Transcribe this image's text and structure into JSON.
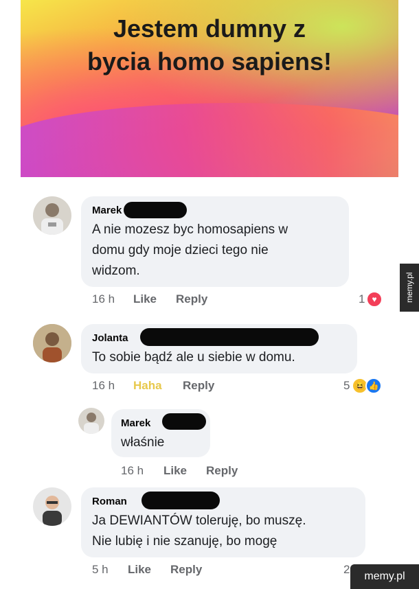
{
  "post": {
    "title_line1": "Jestem dumny z",
    "title_line2": "bycia homo sapiens!"
  },
  "comments": [
    {
      "name": "Marek",
      "lines": [
        "A nie mozesz byc homosapiens w",
        "domu gdy moje dzieci tego nie",
        "widzom."
      ],
      "time": "16 h",
      "like": "Like",
      "reply": "Reply",
      "reaction_count": "1",
      "reaction": "love"
    },
    {
      "name": "Jolanta",
      "lines": [
        "To sobie bądź ale u siebie w domu."
      ],
      "time": "16 h",
      "like": "Haha",
      "reply": "Reply",
      "reaction_count": "5",
      "reaction": "haha+like"
    },
    {
      "name": "Marek",
      "lines": [
        "właśnie"
      ],
      "time": "16 h",
      "like": "Like",
      "reply": "Reply"
    },
    {
      "name": "Roman",
      "lines": [
        "Ja DEWIANTÓW toleruję, bo muszę.",
        "Nie lubię i nie szanuję, bo mogę"
      ],
      "time": "5 h",
      "like": "Like",
      "reply": "Reply",
      "reaction_count": "2"
    }
  ],
  "watermark": {
    "side": "memy.pl",
    "bottom": "memy.pl"
  },
  "colors": {
    "bubble": "#f0f2f5",
    "meta": "#65676b",
    "haha": "#e7c84b",
    "love": "#f33e58",
    "like": "#1877f2"
  }
}
